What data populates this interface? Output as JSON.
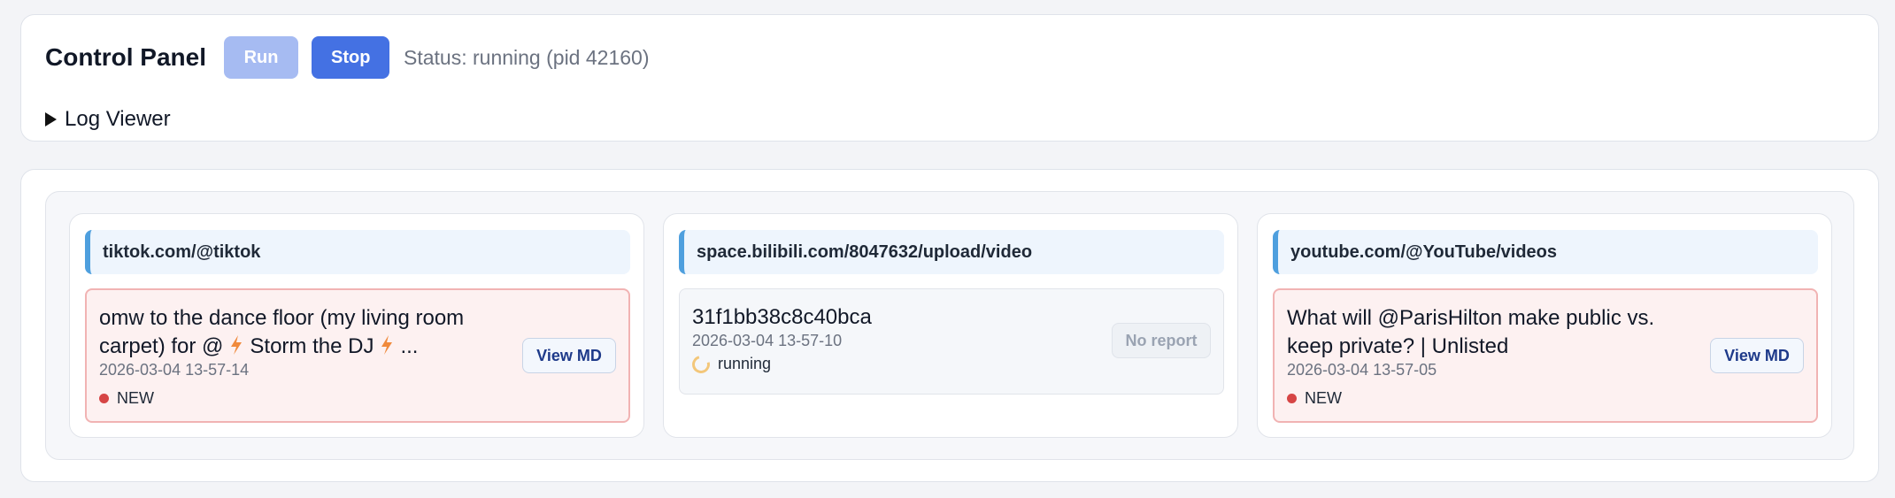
{
  "control_panel": {
    "title": "Control Panel",
    "run_label": "Run",
    "stop_label": "Stop",
    "status": "Status: running (pid 42160)",
    "log_viewer_label": "Log Viewer"
  },
  "columns": [
    {
      "header": "tiktok.com/@tiktok",
      "item": {
        "title_line1": "omw to the dance floor (my living room",
        "title_line2_start": "carpet) for @",
        "title_line2_mid": "Storm the DJ",
        "title_line2_end": "...",
        "icon": "lightning-icon",
        "date": "2026-03-04 13-57-14",
        "status": "NEW",
        "button": "View MD"
      }
    },
    {
      "header": "space.bilibili.com/8047632/upload/video",
      "item": {
        "title": "31f1bb38c8c40bca",
        "date": "2026-03-04 13-57-10",
        "status": "running",
        "button": "No report"
      }
    },
    {
      "header": "youtube.com/@YouTube/videos",
      "item": {
        "title_line1": "What will @ParisHilton make public vs.",
        "title_line2": "keep private? | Unlisted",
        "date": "2026-03-04 13-57-05",
        "status": "NEW",
        "button": "View MD"
      }
    }
  ],
  "colors": {
    "accent": "#4471e3",
    "accent_disabled": "#a6bbf2",
    "new_dot": "#d64545",
    "header_bar": "#4e9fde",
    "spinner": "#f3c77a"
  }
}
